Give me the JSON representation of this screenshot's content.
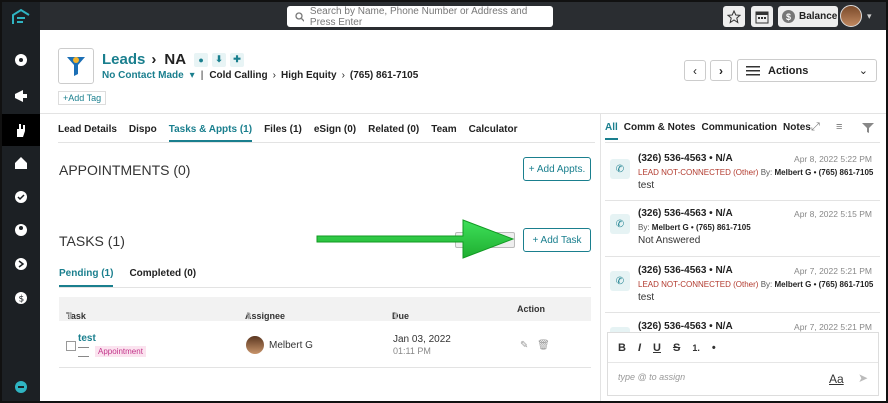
{
  "search": {
    "placeholder": "Search by Name, Phone Number or Address and Press Enter"
  },
  "topbar": {
    "balance_label": "Balance"
  },
  "lead": {
    "breadcrumb_root": "Leads",
    "name": "NA",
    "status": "No Contact Made",
    "path": [
      "Cold Calling",
      "High Equity",
      "(765) 861-7105"
    ],
    "add_tag": "+Add Tag"
  },
  "actions": {
    "label": "Actions"
  },
  "tabs": [
    "Lead Details",
    "Dispo",
    "Tasks & Appts (1)",
    "Files (1)",
    "eSign (0)",
    "Related (0)",
    "Team",
    "Calculator"
  ],
  "appointments": {
    "title": "APPOINTMENTS (0)",
    "add_label": "+ Add Appts."
  },
  "tasks": {
    "title": "TASKS (1)",
    "add_label": "+ Add Task",
    "subtabs": [
      "Pending (1)",
      "Completed (0)"
    ],
    "columns": [
      "Task",
      "Assignee",
      "Due",
      "Action"
    ],
    "rows": [
      {
        "task": "test",
        "badge": "Appointment",
        "assignee": "Melbert G",
        "due_date": "Jan 03, 2022",
        "due_time": "01:11 PM"
      }
    ]
  },
  "right_tabs": [
    "All",
    "Comm & Notes",
    "Communication",
    "Notes"
  ],
  "activity": [
    {
      "number": "(326) 536-4563 • N/A",
      "date": "Apr 8, 2022 5:22 PM",
      "status": "LEAD NOT-CONNECTED (Other)",
      "by": "By:",
      "agent": "Melbert G • (765) 861-7105",
      "text": "test"
    },
    {
      "number": "(326) 536-4563 • N/A",
      "date": "Apr 8, 2022 5:15 PM",
      "status": "",
      "by": "By:",
      "agent": "Melbert G • (765) 861-7105",
      "text": "Not Answered"
    },
    {
      "number": "(326) 536-4563 • N/A",
      "date": "Apr 7, 2022 5:21 PM",
      "status": "LEAD NOT-CONNECTED (Other)",
      "by": "By:",
      "agent": "Melbert G • (765) 861-7105",
      "text": "test"
    },
    {
      "number": "(326) 536-4563 • N/A",
      "date": "Apr 7, 2022 5:21 PM",
      "status": "",
      "by": "",
      "agent": "",
      "text": ""
    }
  ],
  "editor": {
    "tools": [
      "B",
      "I",
      "U",
      "S",
      "1.",
      "•"
    ],
    "placeholder": "type @ to assign",
    "format_label": "Aa"
  },
  "colors": {
    "accent": "#1a7f8e",
    "rail": "#1c2024",
    "arrow": "#2ecc40"
  }
}
